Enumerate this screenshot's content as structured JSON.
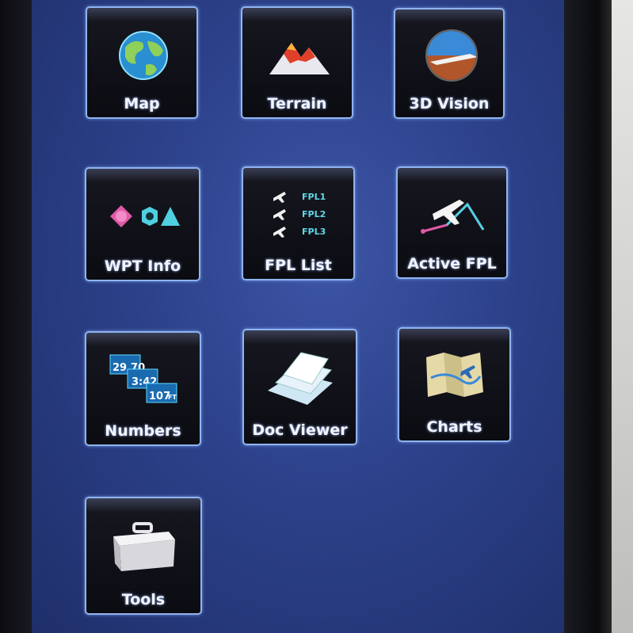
{
  "apps": [
    {
      "id": "map",
      "label": "Map",
      "icon": "globe-icon"
    },
    {
      "id": "terrain",
      "label": "Terrain",
      "icon": "mountain-icon"
    },
    {
      "id": "3d-vision",
      "label": "3D Vision",
      "icon": "synthetic-vision-icon"
    },
    {
      "id": "wpt-info",
      "label": "WPT Info",
      "icon": "waypoint-symbols-icon"
    },
    {
      "id": "fpl-list",
      "label": "FPL List",
      "icon": "flight-plan-list-icon",
      "items": [
        "FPL1",
        "FPL2",
        "FPL3"
      ]
    },
    {
      "id": "active-fpl",
      "label": "Active FPL",
      "icon": "airplane-route-icon"
    },
    {
      "id": "numbers",
      "label": "Numbers",
      "icon": "numeric-readouts-icon",
      "values": [
        "29.70",
        "3:42",
        "107",
        "FT"
      ]
    },
    {
      "id": "doc-viewer",
      "label": "Doc Viewer",
      "icon": "documents-icon"
    },
    {
      "id": "charts",
      "label": "Charts",
      "icon": "folded-chart-icon"
    },
    {
      "id": "tools",
      "label": "Tools",
      "icon": "toolbox-icon"
    }
  ],
  "colors": {
    "screen_bg": "#2c418a",
    "tile_border": "#8fb4f0",
    "accent_cyan": "#5fd8e8",
    "accent_pink": "#e05aa8"
  }
}
